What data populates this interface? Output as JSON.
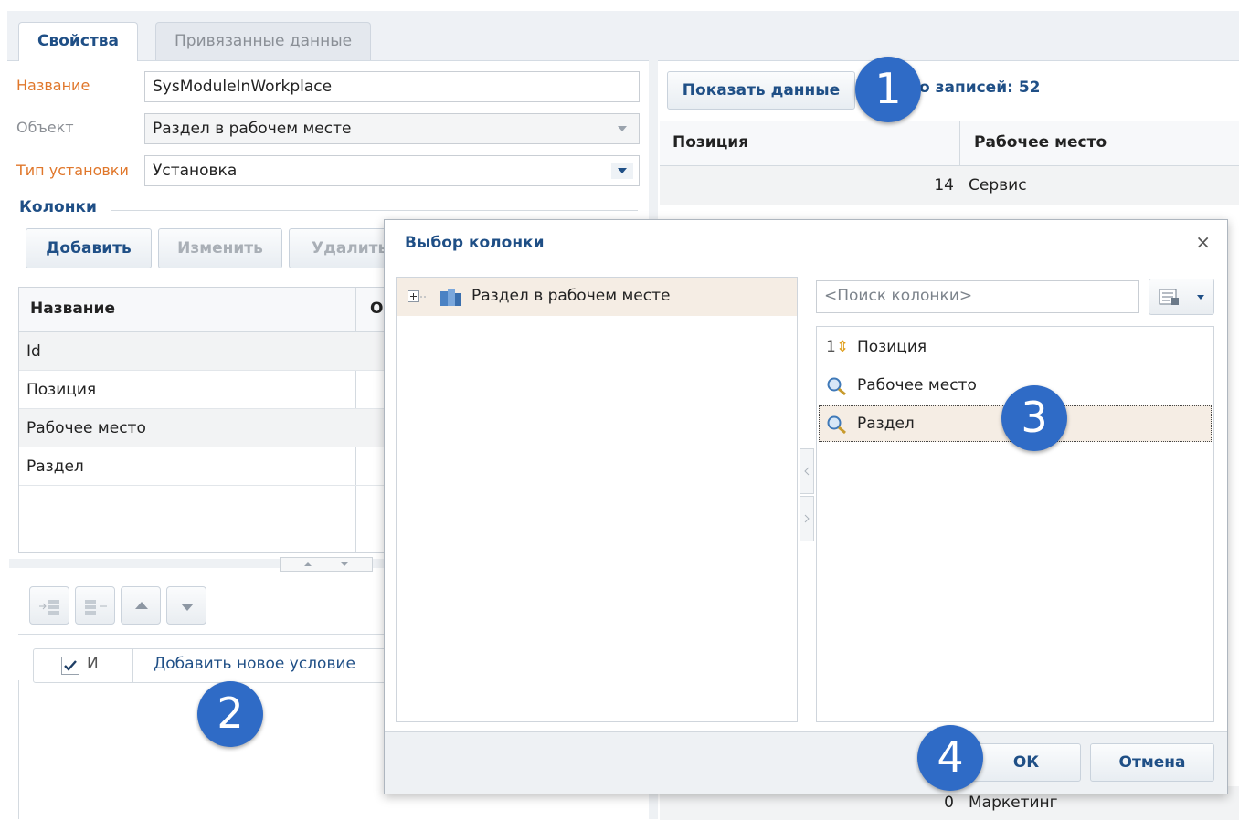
{
  "tabs": [
    {
      "label": "Свойства",
      "active": true
    },
    {
      "label": "Привязанные данные",
      "active": false
    }
  ],
  "form": {
    "name_label": "Название",
    "name_value": "SysModuleInWorkplace",
    "object_label": "Объект",
    "object_value": "Раздел в рабочем месте",
    "install_label": "Тип установки",
    "install_value": "Установка"
  },
  "columns_section": {
    "title": "Колонки",
    "add_label": "Добавить",
    "edit_label": "Изменить",
    "delete_label": "Удалить"
  },
  "columns_grid": {
    "headers": [
      "Название",
      "О"
    ],
    "rows": [
      "Id",
      "Позиция",
      "Рабочее место",
      "Раздел"
    ]
  },
  "filter": {
    "logic_label": "И",
    "add_condition_label": "Добавить новое условие"
  },
  "data_panel": {
    "show_data_label": "Показать данные",
    "records_text": "о записей: 52",
    "headers": [
      "Позиция",
      "Рабочее место"
    ],
    "rows": [
      {
        "position": "14",
        "workplace": "Сервис"
      },
      {
        "position": "0",
        "workplace": "Маркетинг"
      }
    ]
  },
  "dialog": {
    "title": "Выбор колонки",
    "close_glyph": "×",
    "tree_root": "Раздел в рабочем месте",
    "search_placeholder": "<Поиск колонки>",
    "columns": [
      {
        "label": "Позиция",
        "icon": "sort-numeric-icon",
        "prefix": "1"
      },
      {
        "label": "Рабочее место",
        "icon": "lookup-search-icon"
      },
      {
        "label": "Раздел",
        "icon": "lookup-search-icon",
        "selected": true
      }
    ],
    "ok_label": "ОК",
    "cancel_label": "Отмена"
  },
  "callouts": [
    "1",
    "2",
    "3",
    "4"
  ],
  "colors": {
    "accent": "#1f4f86",
    "badge": "#2f6bc6",
    "required_label": "#e0772b",
    "selection": "#f5ede4"
  }
}
